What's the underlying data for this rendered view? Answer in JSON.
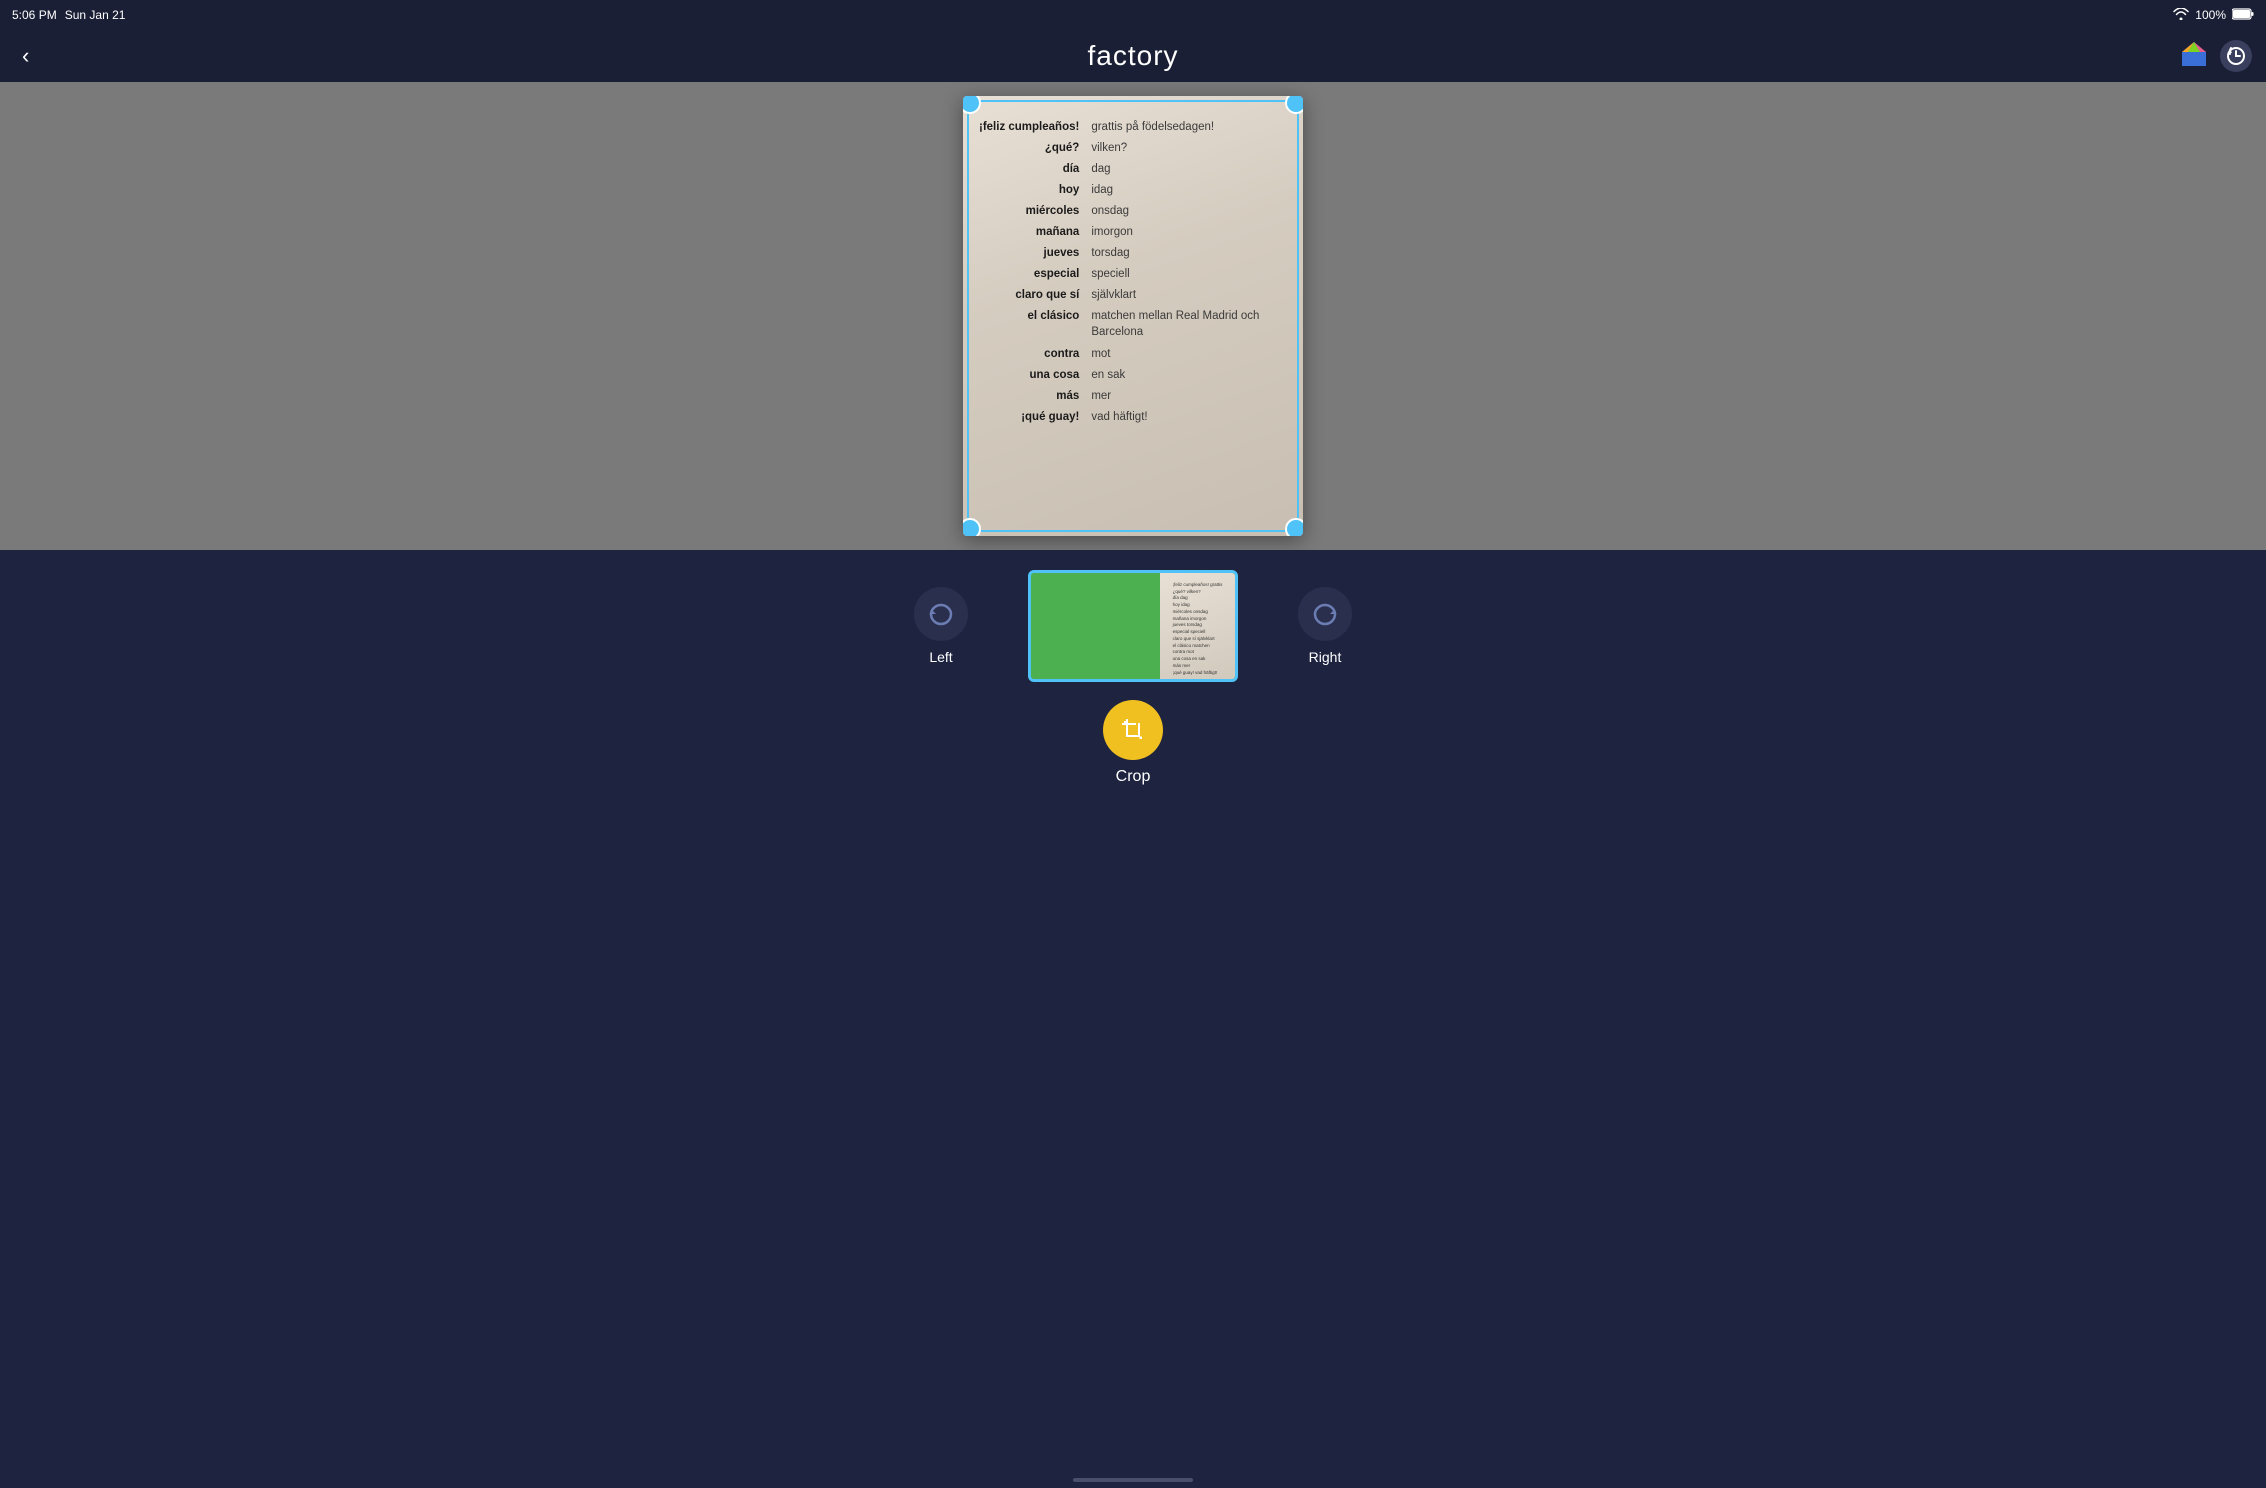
{
  "statusBar": {
    "time": "5:06 PM",
    "date": "Sun Jan 21",
    "battery": "100%",
    "wifi": "WiFi"
  },
  "topBar": {
    "back": "‹",
    "title": "factory"
  },
  "vocab": [
    {
      "spanish": "¡feliz cumpleaños!",
      "swedish": "grattis på\nfödelsedagen!"
    },
    {
      "spanish": "¿qué?",
      "swedish": "vilken?"
    },
    {
      "spanish": "día",
      "swedish": "dag"
    },
    {
      "spanish": "hoy",
      "swedish": "idag"
    },
    {
      "spanish": "miércoles",
      "swedish": "onsdag"
    },
    {
      "spanish": "mañana",
      "swedish": "imorgon"
    },
    {
      "spanish": "jueves",
      "swedish": "torsdag"
    },
    {
      "spanish": "especial",
      "swedish": "speciell"
    },
    {
      "spanish": "claro que sí",
      "swedish": "självklart"
    },
    {
      "spanish": "el clásico",
      "swedish": "matchen mellan\nReal Madrid och\nBarcelona"
    },
    {
      "spanish": "contra",
      "swedish": "mot"
    },
    {
      "spanish": "una cosa",
      "swedish": "en sak"
    },
    {
      "spanish": "más",
      "swedish": "mer"
    },
    {
      "spanish": "¡qué guay!",
      "swedish": "vad häftigt!"
    }
  ],
  "toolbar": {
    "leftLabel": "Left",
    "rightLabel": "Right",
    "cropLabel": "Crop"
  }
}
